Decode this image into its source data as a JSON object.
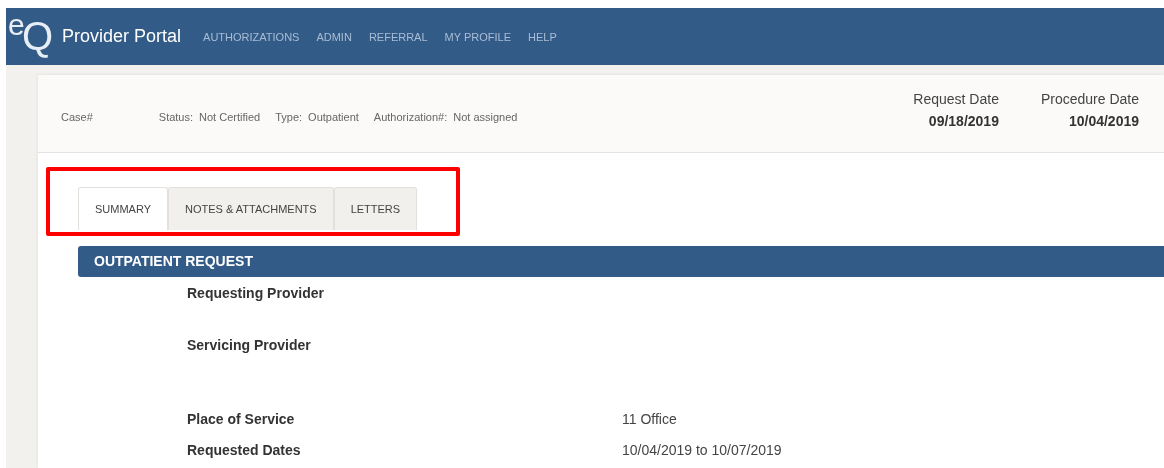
{
  "header": {
    "logo": [
      "e",
      "Q"
    ],
    "title": "Provider Portal",
    "nav": [
      {
        "label": "AUTHORIZATIONS"
      },
      {
        "label": "ADMIN"
      },
      {
        "label": "REFERRAL"
      },
      {
        "label": "MY PROFILE"
      },
      {
        "label": "HELP"
      }
    ]
  },
  "case": {
    "fields": [
      {
        "label": "Case#"
      },
      {
        "label": "Status:",
        "value": "Not Certified"
      },
      {
        "label": "Type:",
        "value": "Outpatient"
      },
      {
        "label": "Authorization#:",
        "value": "Not assigned"
      }
    ],
    "dates": [
      {
        "label": "Request Date",
        "value": "09/18/2019"
      },
      {
        "label": "Procedure Date",
        "value": "10/04/2019"
      }
    ]
  },
  "tabs": [
    {
      "label": "SUMMARY",
      "selected": true
    },
    {
      "label": "NOTES & ATTACHMENTS",
      "selected": false
    },
    {
      "label": "LETTERS",
      "selected": false
    }
  ],
  "section": {
    "title": "OUTPATIENT REQUEST",
    "rows": [
      {
        "label": "Requesting Provider"
      },
      {
        "label": "Servicing Provider"
      },
      {
        "label": "Place of Service",
        "value": "11 Office"
      },
      {
        "label": "Requested Dates",
        "value": "10/04/2019 to 10/07/2019"
      }
    ]
  }
}
